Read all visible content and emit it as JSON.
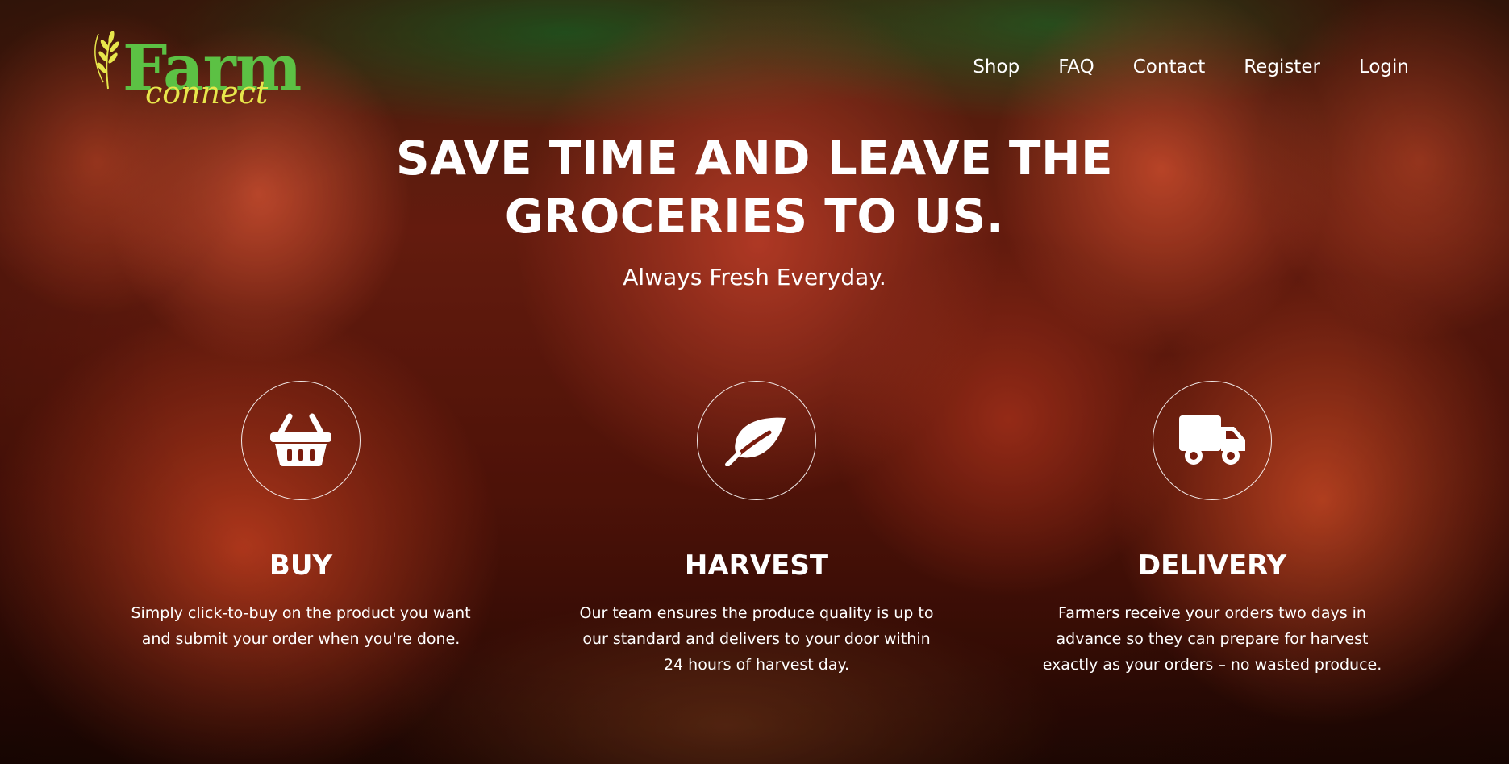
{
  "brand": {
    "name": "Farm",
    "tagline": "connect"
  },
  "nav": {
    "items": [
      "Shop",
      "FAQ",
      "Contact",
      "Register",
      "Login"
    ]
  },
  "hero": {
    "title": "SAVE TIME AND LEAVE THE GROCERIES TO US.",
    "subtitle": "Always Fresh Everyday."
  },
  "features": [
    {
      "icon": "basket-icon",
      "title": "BUY",
      "text": "Simply click-to-buy on the product you want and submit your order when you're done."
    },
    {
      "icon": "leaf-icon",
      "title": "HARVEST",
      "text": "Our team ensures the produce quality is up to our standard and delivers to your door within 24 hours of harvest day."
    },
    {
      "icon": "truck-icon",
      "title": "DELIVERY",
      "text": "Farmers receive your orders two days in advance so they can prepare for harvest exactly as your orders – no wasted produce."
    }
  ],
  "colors": {
    "logo_green": "#5cc144",
    "logo_yellow": "#e7e64b",
    "text": "#ffffff"
  }
}
